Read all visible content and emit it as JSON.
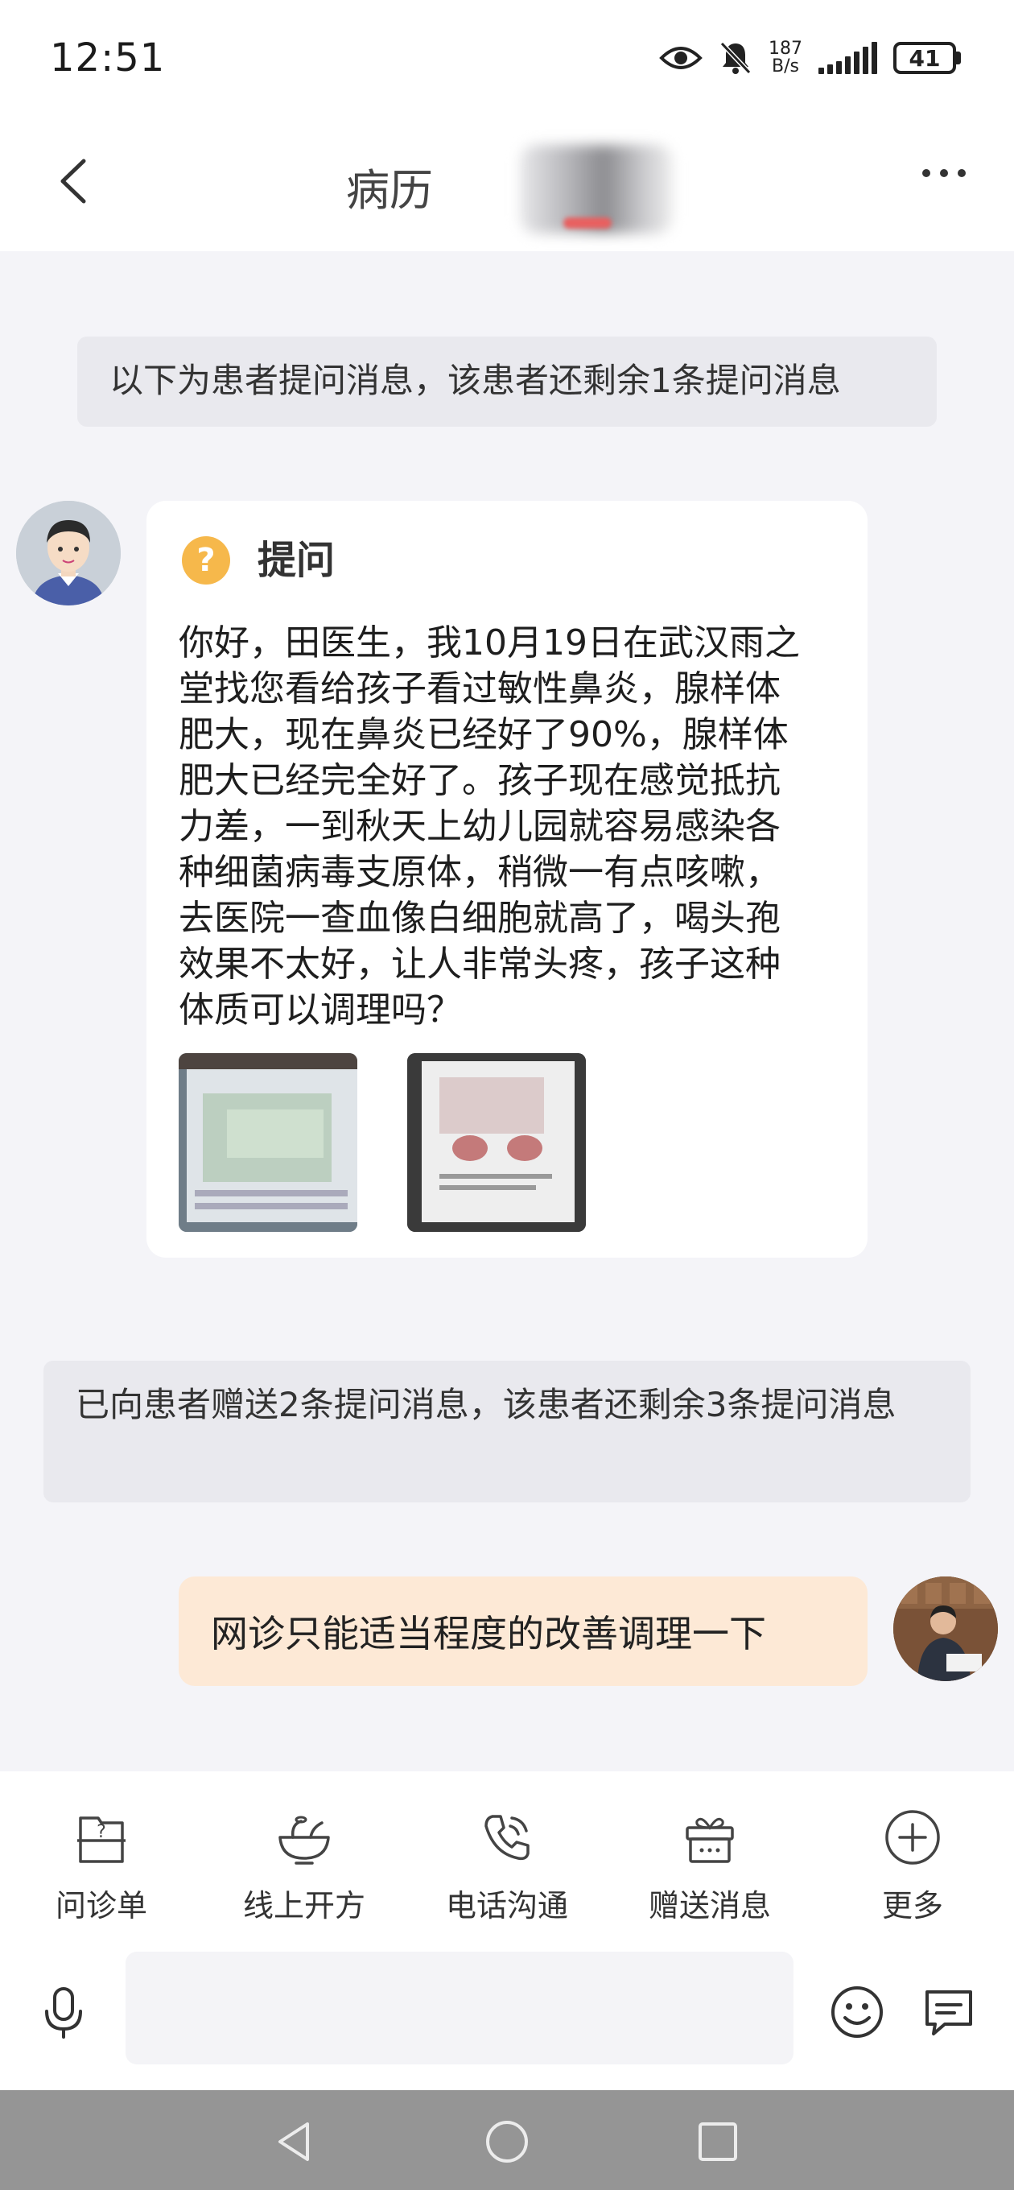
{
  "status_bar": {
    "time": "12:51",
    "net_speed_value": "187",
    "net_speed_unit": "B/s",
    "battery": "41"
  },
  "header": {
    "title": "病历"
  },
  "notices": {
    "top": "以下为患者提问消息，该患者还剩余1条提问消息",
    "gift": "已向患者赠送2条提问消息，该患者还剩余3条提问消息"
  },
  "question": {
    "icon_glyph": "?",
    "title": "提问",
    "lines": [
      "你好，田医生，我10月19日在武汉雨之",
      "堂找您看给孩子看过敏性鼻炎，腺样体",
      "肥大，现在鼻炎已经好了90%，腺样体",
      "肥大已经完全好了。孩子现在感觉抵抗",
      "力差，一到秋天上幼儿园就容易感染各",
      "种细菌病毒支原体，稍微一有点咳嗽，",
      "去医院一查血像白细胞就高了，喝头孢",
      "效果不太好，让人非常头疼，孩子这种",
      "体质可以调理吗？"
    ]
  },
  "reply": {
    "text": "网诊只能适当程度的改善调理一下"
  },
  "toolbar": {
    "items": [
      {
        "label": "问诊单",
        "icon": "inquiry-form-icon"
      },
      {
        "label": "线上开方",
        "icon": "herb-bowl-icon"
      },
      {
        "label": "电话沟通",
        "icon": "phone-icon"
      },
      {
        "label": "赠送消息",
        "icon": "gift-icon"
      },
      {
        "label": "更多",
        "icon": "plus-circle-icon"
      }
    ]
  },
  "composer": {
    "value": "",
    "placeholder": ""
  },
  "colors": {
    "page_bg": "#f4f4f8",
    "notice_bg": "#e9e9ee",
    "reply_bubble": "#fde9d6",
    "question_icon": "#f6b84b",
    "nav_bar": "#959595"
  }
}
